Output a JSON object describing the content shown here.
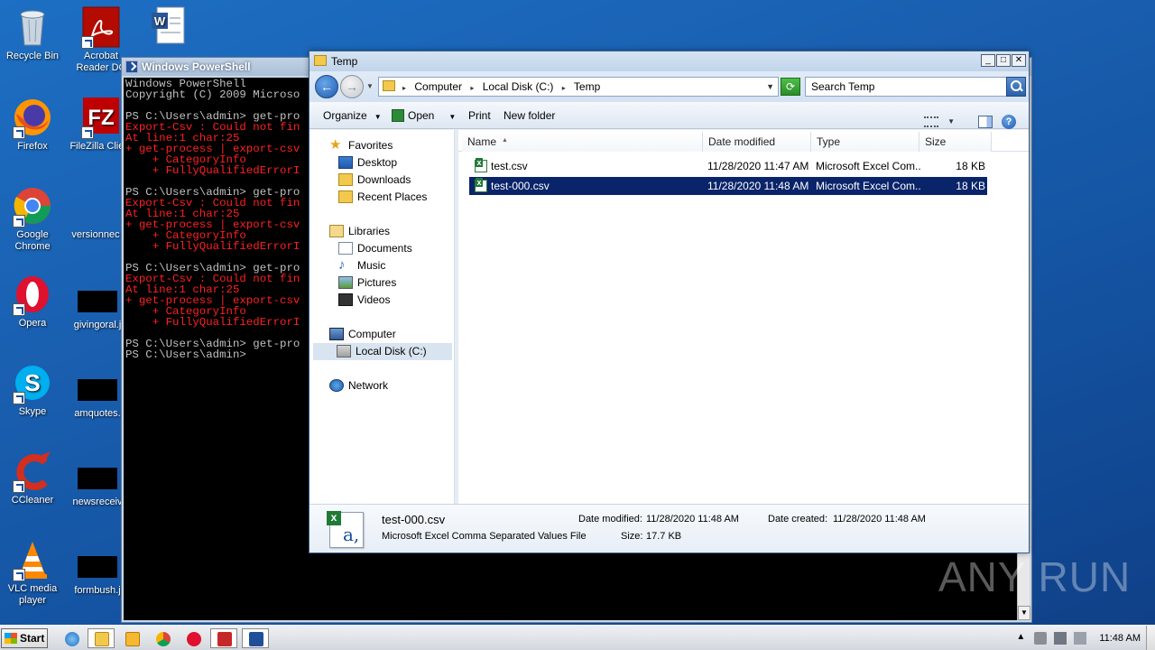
{
  "desktop": {
    "icons": [
      {
        "label": "Recycle Bin"
      },
      {
        "label": "Acrobat Reader DC"
      },
      {
        "label": "Firefox"
      },
      {
        "label": "FileZilla Client"
      },
      {
        "label": "Google Chrome"
      },
      {
        "label": "versionnec"
      },
      {
        "label": "Opera"
      },
      {
        "label": "givingoral.j"
      },
      {
        "label": "Skype"
      },
      {
        "label": "amquotes."
      },
      {
        "label": "CCleaner"
      },
      {
        "label": "newsreceiv"
      },
      {
        "label": "VLC media player"
      },
      {
        "label": "formbush.j"
      }
    ]
  },
  "powershell": {
    "title": "Windows PowerShell",
    "lines": [
      {
        "text": "Windows PowerShell",
        "type": "normal"
      },
      {
        "text": "Copyright (C) 2009 Microso",
        "type": "normal"
      },
      {
        "text": "",
        "type": "gap"
      },
      {
        "text": "PS C:\\Users\\admin> get-pro",
        "type": "normal"
      },
      {
        "text": "Export-Csv : Could not fin",
        "type": "err"
      },
      {
        "text": "At line:1 char:25",
        "type": "err"
      },
      {
        "text": "+ get-process | export-csv",
        "type": "err"
      },
      {
        "text": "    + CategoryInfo",
        "type": "err"
      },
      {
        "text": "    + FullyQualifiedErrorI",
        "type": "err"
      },
      {
        "text": "",
        "type": "gap"
      },
      {
        "text": "PS C:\\Users\\admin> get-pro",
        "type": "normal"
      },
      {
        "text": "Export-Csv : Could not fin",
        "type": "err"
      },
      {
        "text": "At line:1 char:25",
        "type": "err"
      },
      {
        "text": "+ get-process | export-csv",
        "type": "err"
      },
      {
        "text": "    + CategoryInfo",
        "type": "err"
      },
      {
        "text": "    + FullyQualifiedErrorI",
        "type": "err"
      },
      {
        "text": "",
        "type": "gap"
      },
      {
        "text": "PS C:\\Users\\admin> get-pro",
        "type": "normal"
      },
      {
        "text": "Export-Csv : Could not fin",
        "type": "err"
      },
      {
        "text": "At line:1 char:25",
        "type": "err"
      },
      {
        "text": "+ get-process | export-csv",
        "type": "err"
      },
      {
        "text": "    + CategoryInfo",
        "type": "err"
      },
      {
        "text": "    + FullyQualifiedErrorI",
        "type": "err"
      },
      {
        "text": "",
        "type": "gap"
      },
      {
        "text": "PS C:\\Users\\admin> get-pro",
        "type": "normal"
      },
      {
        "text": "PS C:\\Users\\admin>",
        "type": "normal"
      }
    ]
  },
  "explorer": {
    "title": "Temp",
    "breadcrumb": [
      "Computer",
      "Local Disk (C:)",
      "Temp"
    ],
    "search_placeholder": "Search Temp",
    "toolbar": {
      "organize": "Organize",
      "open": "Open",
      "print": "Print",
      "new_folder": "New folder"
    },
    "nav": {
      "favorites": "Favorites",
      "desktop": "Desktop",
      "downloads": "Downloads",
      "recent_places": "Recent Places",
      "libraries": "Libraries",
      "documents": "Documents",
      "music": "Music",
      "pictures": "Pictures",
      "videos": "Videos",
      "computer": "Computer",
      "local_disk": "Local Disk (C:)",
      "network": "Network"
    },
    "columns": {
      "name": "Name",
      "date_modified": "Date modified",
      "type": "Type",
      "size": "Size"
    },
    "files": [
      {
        "name": "test.csv",
        "date": "11/28/2020 11:47 AM",
        "type": "Microsoft Excel Com...",
        "size": "18 KB"
      },
      {
        "name": "test-000.csv",
        "date": "11/28/2020 11:48 AM",
        "type": "Microsoft Excel Com...",
        "size": "18 KB"
      }
    ],
    "details": {
      "filename": "test-000.csv",
      "filetype": "Microsoft Excel Comma Separated Values File",
      "date_modified_label": "Date modified:",
      "date_modified": "11/28/2020 11:48 AM",
      "date_created_label": "Date created:",
      "date_created": "11/28/2020 11:48 AM",
      "size_label": "Size:",
      "size": "17.7 KB"
    }
  },
  "taskbar": {
    "start_label": "Start",
    "clock": "11:48 AM"
  },
  "watermark": "ANY RUN"
}
